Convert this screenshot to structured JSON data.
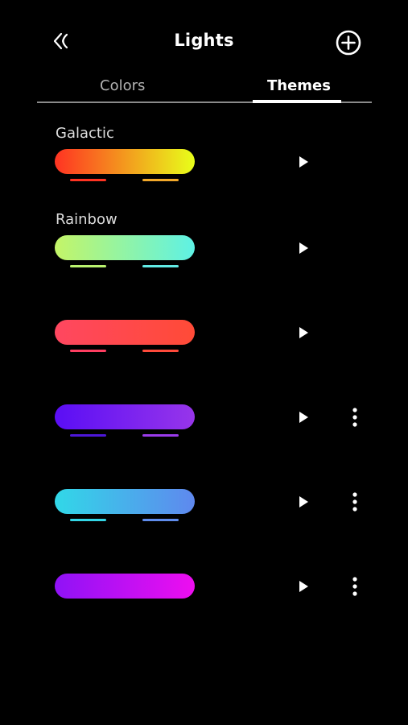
{
  "header": {
    "title": "Lights",
    "back_icon": "back-icon",
    "add_icon": "plus-circle-icon"
  },
  "tabs": [
    {
      "label": "Colors",
      "active": false
    },
    {
      "label": "Themes",
      "active": true
    }
  ],
  "themes": [
    {
      "name": "Galactic",
      "gradient": [
        "#ff3322",
        "#e8ff1a"
      ],
      "dash_left": "#ff3322",
      "dash_right": "#f2a82a",
      "has_more": false
    },
    {
      "name": "Rainbow",
      "gradient": [
        "#c4f567",
        "#5ef2e5"
      ],
      "dash_left": "#b9f26e",
      "dash_right": "#62ebe5",
      "has_more": false
    },
    {
      "name": "",
      "gradient": [
        "#ff4760",
        "#ff4b37"
      ],
      "dash_left": "#ff3e61",
      "dash_right": "#ff4a3b",
      "has_more": false
    },
    {
      "name": "",
      "gradient": [
        "#5a0ef5",
        "#9735ea"
      ],
      "dash_left": "#4d17d8",
      "dash_right": "#9a3bea",
      "has_more": true
    },
    {
      "name": "",
      "gradient": [
        "#31d8e8",
        "#5f88ee"
      ],
      "dash_left": "#33d6e6",
      "dash_right": "#5f8cec",
      "has_more": true
    },
    {
      "name": "",
      "gradient": [
        "#8f12f6",
        "#ee0ef0"
      ],
      "dash_left": "",
      "dash_right": "",
      "has_more": true
    }
  ]
}
